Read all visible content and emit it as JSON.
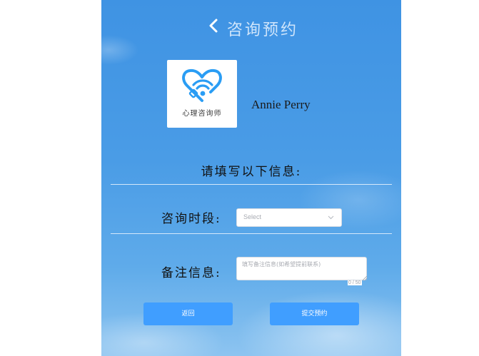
{
  "header": {
    "title": "咨询预约"
  },
  "counselor": {
    "logo_text": "心理咨询师",
    "name": "Annie Perry"
  },
  "form": {
    "heading": "请填写以下信息:",
    "time_label": "咨询时段:",
    "time_select": {
      "placeholder": "Select"
    },
    "notes_label": "备注信息:",
    "notes_input": {
      "placeholder": "填写备注信息(如希望提前联系)",
      "counter": "0 / 50"
    }
  },
  "buttons": {
    "back_label": "返回",
    "submit_label": "提交预约"
  },
  "colors": {
    "accent": "#409eff",
    "panel_top": "#3f93e3",
    "panel_bottom": "#8dc4f0",
    "logo": "#2a9df4"
  }
}
